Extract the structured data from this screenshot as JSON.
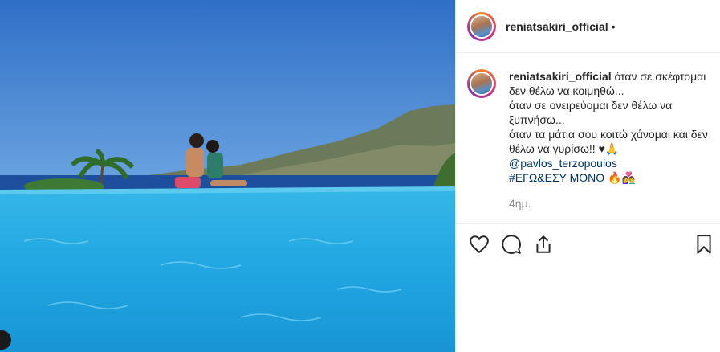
{
  "post": {
    "username": "reniatsakiri_official",
    "header_dot": "•",
    "caption_lines": [
      "όταν σε σκέφτομαι δεν θέλω να κοιμηθώ...",
      "όταν σε ονειρεύομαι δεν θέλω να ξυπνήσω...",
      "όταν τα μάτια σου κοιτώ χάνομαι και δεν θέλω να γυρίσω!! ♥🙏"
    ],
    "mention": "@pavlos_terzopoulos",
    "hashtag_line": "#ΕΓΩ&ΕΣΥ ΜΟΝΟ 🔥👩‍❤️‍👨",
    "time": "4ημ."
  },
  "icons": [
    "heart-icon",
    "comment-icon",
    "share-icon",
    "bookmark-icon"
  ],
  "colors": {
    "link": "#003569",
    "text": "#262626",
    "muted": "#8e8e8e",
    "divider": "#efefef"
  }
}
